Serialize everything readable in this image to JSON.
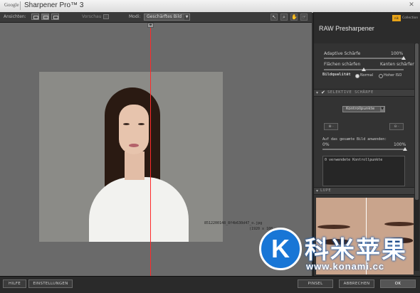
{
  "window": {
    "brand": "Google",
    "app_title": "Sharpener Pro™ 3"
  },
  "toolbar": {
    "views_label": "Ansichten:",
    "preview_label": "Vorschau",
    "mode_label": "Modi:",
    "mode_value": "Geschärftes Bild"
  },
  "canvas": {
    "filename": "8512200148_8f4b630d47_o.jpg",
    "dimensions": "(1920 x 108"
  },
  "panel": {
    "collection_badge": "nik",
    "collection_label": "Collection",
    "title": "RAW Presharpener",
    "adaptive_label": "Adaptive Schärfe",
    "adaptive_value": "100%",
    "adaptive_level": 1.0,
    "surfaces_label": "Flächen schärfen",
    "edges_label": "Kanten schärfen",
    "surfaces_edges_balance": 0.5,
    "quality_label": "Bildqualität",
    "quality_normal": "Normal",
    "quality_high": "Hoher ISO",
    "selective_label": "SELEKTIVE SCHÄRFE",
    "controlpoints_select": "Kontrollpunkte",
    "apply_label": "Auf das gesamte Bild anwenden:",
    "apply_min": "0%",
    "apply_max": "100%",
    "apply_level": 1.0,
    "list_text": "0 verwendete Kontrollpunkte",
    "loupe_label": "LUPE"
  },
  "bottom": {
    "help": "HILFE",
    "settings": "EINSTELLUNGEN",
    "brush": "PINSEL",
    "cancel": "ABBRECHEN",
    "ok": "OK"
  },
  "watermark": {
    "logo_letter": "K",
    "chinese": "科米苹果",
    "url": "www.konami.cc"
  },
  "colors": {
    "split_line": "#ff2a2a",
    "nik_badge": "#e8a318",
    "watermark_blue": "#1876d6"
  }
}
